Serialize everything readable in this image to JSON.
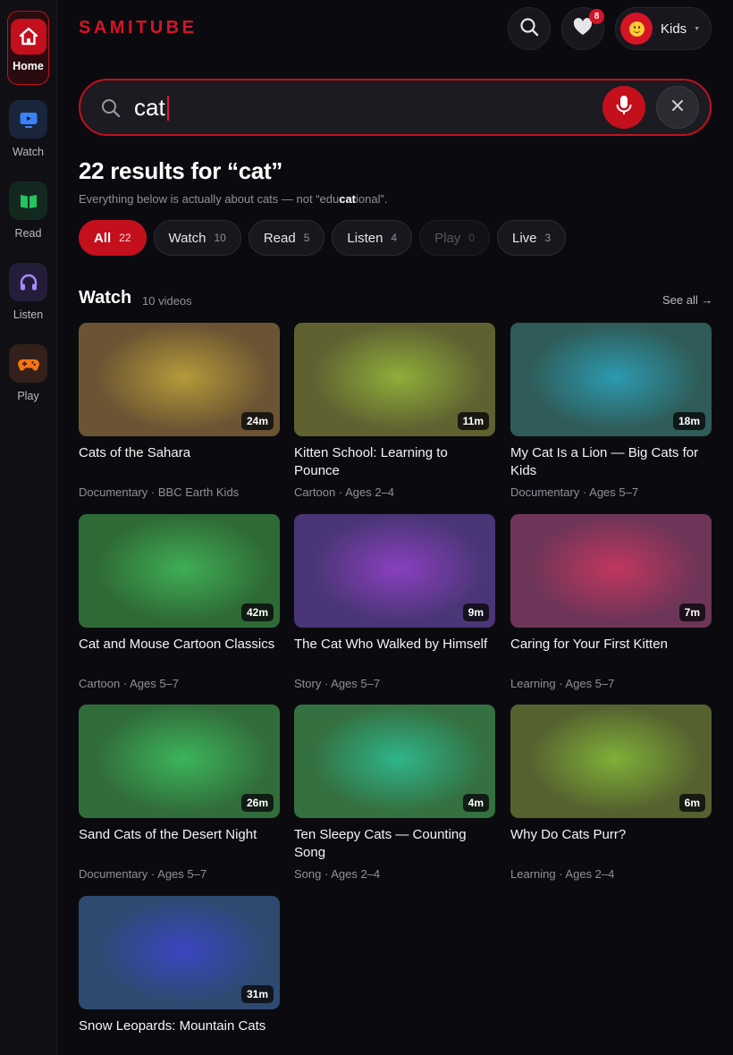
{
  "app": {
    "logo": "SAMITUBE"
  },
  "sidebar": {
    "items": [
      {
        "label": "Home",
        "icon": "home-icon",
        "active": true
      },
      {
        "label": "Watch",
        "icon": "tv-icon",
        "color": "#3b82f6"
      },
      {
        "label": "Read",
        "icon": "book-icon",
        "color": "#22c55e"
      },
      {
        "label": "Listen",
        "icon": "headphones-icon",
        "color": "#a78bfa"
      },
      {
        "label": "Play",
        "icon": "gamepad-icon",
        "color": "#f97316"
      }
    ]
  },
  "header": {
    "favorites_count": "8",
    "profile_name": "Kids"
  },
  "search": {
    "value": "cat",
    "placeholder": "Search"
  },
  "results": {
    "title": "22 results for “cat”",
    "note_prefix": "Everything below is actually about cats — not “edu",
    "note_highlight": "cat",
    "note_suffix": "ional”."
  },
  "filters": [
    {
      "label": "All",
      "count": "22",
      "state": "active"
    },
    {
      "label": "Watch",
      "count": "10",
      "state": "normal"
    },
    {
      "label": "Read",
      "count": "5",
      "state": "normal"
    },
    {
      "label": "Listen",
      "count": "4",
      "state": "normal"
    },
    {
      "label": "Play",
      "count": "0",
      "state": "disabled"
    },
    {
      "label": "Live",
      "count": "3",
      "state": "normal"
    }
  ],
  "watch_section": {
    "title": "Watch",
    "count_label": "10 videos",
    "see_all": "See all →",
    "videos": [
      {
        "title": "Cats of the Sahara",
        "meta": "Documentary · BBC Earth Kids",
        "duration": "24m",
        "color_a": "#b59a3a",
        "color_b": "#6b5433"
      },
      {
        "title": "Kitten School: Learning to Pounce",
        "meta": "Cartoon · Ages 2–4",
        "duration": "11m",
        "color_a": "#8fae3a",
        "color_b": "#5f6131"
      },
      {
        "title": "My Cat Is a Lion — Big Cats for Kids",
        "meta": "Documentary · Ages 5–7",
        "duration": "18m",
        "color_a": "#2c9ab0",
        "color_b": "#2f5c58"
      },
      {
        "title": "Cat and Mouse Cartoon Classics",
        "meta": "Cartoon · Ages 5–7",
        "duration": "42m",
        "color_a": "#3fae54",
        "color_b": "#2f6a36"
      },
      {
        "title": "The Cat Who Walked by Himself",
        "meta": "Story · Ages 5–7",
        "duration": "9m",
        "color_a": "#8a3fbf",
        "color_b": "#4a3676"
      },
      {
        "title": "Caring for Your First Kitten",
        "meta": "Learning · Ages 5–7",
        "duration": "7m",
        "color_a": "#c0365e",
        "color_b": "#6d3558"
      },
      {
        "title": "Sand Cats of the Desert Night",
        "meta": "Documentary · Ages 5–7",
        "duration": "26m",
        "color_a": "#3cb55a",
        "color_b": "#316d3b"
      },
      {
        "title": "Ten Sleepy Cats — Counting Song",
        "meta": "Song · Ages 2–4",
        "duration": "4m",
        "color_a": "#2fb58a",
        "color_b": "#347040"
      },
      {
        "title": "Why Do Cats Purr?",
        "meta": "Learning · Ages 2–4",
        "duration": "6m",
        "color_a": "#7fb038",
        "color_b": "#55612f"
      },
      {
        "title": "Snow Leopards: Mountain Cats",
        "meta": "",
        "duration": "31m",
        "color_a": "#3b46c0",
        "color_b": "#2e4a70"
      }
    ]
  }
}
